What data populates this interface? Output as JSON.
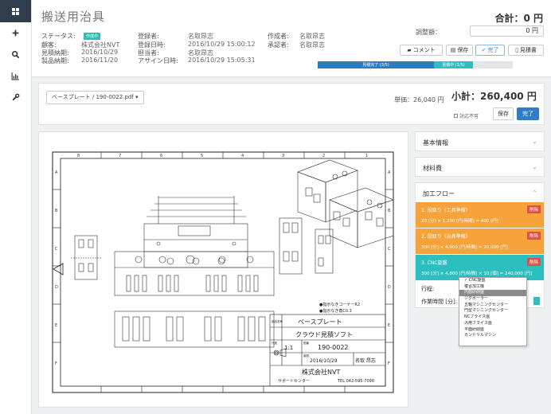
{
  "nav": {
    "items": [
      "grid-icon",
      "plus-icon",
      "search-icon",
      "chart-icon",
      "wrench-icon"
    ]
  },
  "header": {
    "title": "搬送用治具",
    "status_label": "ステータス:",
    "status_value": "作成中",
    "customer_label": "顧客:",
    "customer_value": "株式会社NVT",
    "quote_due_label": "見積納期:",
    "quote_due_value": "2016/10/29",
    "product_due_label": "製品納期:",
    "product_due_value": "2016/11/20",
    "registrant_label": "登録者:",
    "registrant_value": "名取昂志",
    "reg_date_label": "登録日時:",
    "reg_date_value": "2016/10/29 15:00:12",
    "assignee_label": "担当者:",
    "assignee_value": "名取昂志",
    "assign_date_label": "アサイン日時:",
    "assign_date_value": "2016/10/29 15:05:31",
    "creator_label": "作成者:",
    "creator_value": "名取昂志",
    "approver_label": "承認者:",
    "approver_value": "名取昂志",
    "total": "合計：0 円",
    "adjust_label": "調整額：",
    "adjust_value": "0",
    "adjust_unit": "円",
    "btn_comment": "コメント",
    "btn_save": "保存",
    "btn_done": "完了",
    "btn_quote": "見積書",
    "progress_1": "見積完了 (3/5)",
    "progress_2": "見積中 (1/5)"
  },
  "filebar": {
    "file": "ベースプレート / 190-0022.pdf ▾",
    "unit_price": "単価：26,040 円",
    "subtotal": "小計：260,400 円",
    "not_supported": "対応不可",
    "save": "保存",
    "done": "完了"
  },
  "drawing": {
    "part_name_label": "部品名称",
    "part_name": "ベースプレート",
    "system": "クラウド見積ソフト",
    "scale_label": "尺度",
    "scale": "1:1",
    "drawing_no_label": "図番",
    "drawing_no": "190-0022",
    "date_label": "製図",
    "date": "2016/10/29",
    "drafter_label": "製図",
    "drafter": "名取 昂志",
    "company": "株式会社NVT",
    "center": "サポートセンター",
    "tel": "TEL 042-595-7090",
    "note1": "●指示なきコーナーR2",
    "note2": "●指示なき角C0.3",
    "letters": [
      "A",
      "B",
      "C",
      "D",
      "E",
      "F"
    ],
    "numbers": [
      "1",
      "2",
      "3",
      "4",
      "5",
      "6",
      "7",
      "8"
    ]
  },
  "right": {
    "basic_info": "基本情報",
    "material_cost": "材料費",
    "process_flow": "加工フロー",
    "steps": [
      {
        "title": "1. 段取り（工具準備）",
        "detail": "20 [分] × 1,200 [円/時間] = 400 [円]",
        "color": "#f5a33a"
      },
      {
        "title": "2. 段取り（治具準備）",
        "detail": "300 [分] × 4,000 [円/時間] = 20,000 [円]",
        "color": "#f5a33a"
      },
      {
        "title": "3. CNC旋盤",
        "detail": "300 [分] × 4,800 [円/時間] × 10 [個] = 240,000 [円]",
        "color": "#2dbfc0"
      }
    ],
    "delete": "削除",
    "process_label": "行程:",
    "work_time_label": "作業時間 [分]:",
    "dropdown": [
      "✓ CNC旋盤",
      "複合加工機",
      "内面研削盤",
      "ジグボーラー",
      "五軸マシニングセンター",
      "門型マシニングセンター",
      "NCフライス盤",
      "汎用フライス盤",
      "平面研削盤",
      "ガンドリルマシン"
    ],
    "dropdown_selected": 2
  }
}
